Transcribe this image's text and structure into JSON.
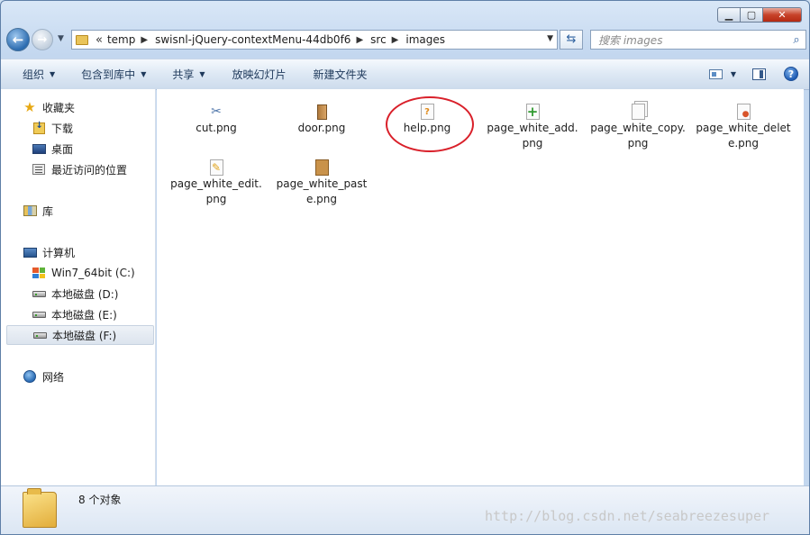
{
  "address": {
    "history_glyph": "«",
    "crumbs": [
      "temp",
      "swisnl-jQuery-contextMenu-44db0f6",
      "src",
      "images"
    ]
  },
  "search": {
    "placeholder": "搜索 images"
  },
  "toolbar": {
    "organize": "组织",
    "include_in_library": "包含到库中",
    "share": "共享",
    "slideshow": "放映幻灯片",
    "new_folder": "新建文件夹"
  },
  "nav": {
    "favorites": "收藏夹",
    "downloads": "下载",
    "desktop": "桌面",
    "recent": "最近访问的位置",
    "libraries": "库",
    "computer": "计算机",
    "drive_c": "Win7_64bit (C:)",
    "drive_d": "本地磁盘 (D:)",
    "drive_e": "本地磁盘 (E:)",
    "drive_f": "本地磁盘 (F:)",
    "network": "网络"
  },
  "files": [
    {
      "name": "cut.png",
      "icon": "scissors-icon"
    },
    {
      "name": "door.png",
      "icon": "door-icon"
    },
    {
      "name": "help.png",
      "icon": "help-question-icon"
    },
    {
      "name": "page_white_add.png",
      "icon": "page-add-icon"
    },
    {
      "name": "page_white_copy.png",
      "icon": "page-copy-icon"
    },
    {
      "name": "page_white_delete.png",
      "icon": "page-delete-icon"
    },
    {
      "name": "page_white_edit.png",
      "icon": "page-edit-icon"
    },
    {
      "name": "page_white_paste.png",
      "icon": "page-paste-icon"
    }
  ],
  "details": {
    "count": "8 个对象"
  },
  "watermark": "http://blog.csdn.net/seabreezesuper",
  "colors": {
    "highlight": "#d9202a",
    "accent": "#2c5f9e"
  }
}
